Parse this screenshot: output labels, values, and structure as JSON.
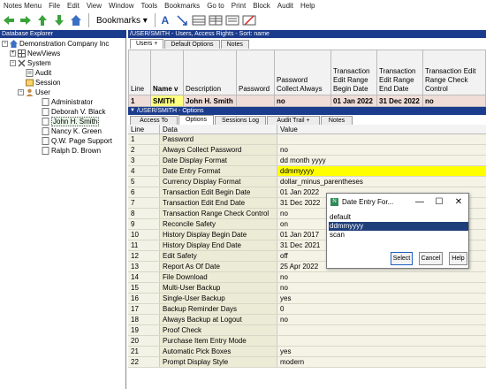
{
  "menu": [
    "Notes Menu",
    "File",
    "Edit",
    "View",
    "Window",
    "Tools",
    "Bookmarks",
    "Go to",
    "Print",
    "Block",
    "Audit",
    "Help"
  ],
  "toolbar": {
    "bookmarks_label": "Bookmarks"
  },
  "explorer": {
    "title": "Database Explorer",
    "root": "Demonstration Company Inc",
    "items": {
      "newviews": "NewViews",
      "system": "System",
      "audit": "Audit",
      "session": "Session",
      "user": "User",
      "users": [
        "Administrator",
        "Deborah V. Black",
        "John H. Smith",
        "Nancy K. Green",
        "Q.W. Page Support",
        "Ralph D. Brown"
      ]
    }
  },
  "user_panel": {
    "title": "/USER/SMITH - Users, Access Rights - Sort: name",
    "tabs": [
      "Users +",
      "Default Options",
      "Notes"
    ],
    "columns": [
      "Line",
      "Name v",
      "Description",
      "Password",
      "Password Collect Always",
      "Transaction Edit Range Begin Date",
      "Transaction Edit Range End Date",
      "Transaction Edit Range Check Control"
    ],
    "row": [
      "1",
      "SMITH",
      "John H. Smith",
      "",
      "no",
      "01 Jan 2022",
      "31 Dec 2022",
      "no"
    ]
  },
  "options_panel": {
    "title": "/USER/SMITH - Options",
    "tabs": [
      "Access To",
      "Options",
      "Sessions Log",
      "Audit Trail +",
      "Notes"
    ],
    "columns": [
      "Line",
      "Data",
      "Value"
    ],
    "rows": [
      [
        "1",
        "Password",
        ""
      ],
      [
        "2",
        "Always Collect Password",
        "no"
      ],
      [
        "3",
        "Date Display Format",
        "dd month yyyy"
      ],
      [
        "4",
        "Date Entry Format",
        "ddmmyyyy"
      ],
      [
        "5",
        "Currency Display Format",
        "dollar_minus_parentheses"
      ],
      [
        "6",
        "Transaction Edit Begin Date",
        "01 Jan 2022"
      ],
      [
        "7",
        "Transaction Edit End Date",
        "31 Dec 2022"
      ],
      [
        "8",
        "Transaction Range Check Control",
        "no"
      ],
      [
        "9",
        "Reconcile Safety",
        "on"
      ],
      [
        "10",
        "History Display Begin Date",
        "01 Jan 2017"
      ],
      [
        "11",
        "History Display End Date",
        "31 Dec 2021"
      ],
      [
        "12",
        "Edit Safety",
        "off"
      ],
      [
        "13",
        "Report As Of Date",
        "25 Apr 2022"
      ],
      [
        "14",
        "File Download",
        "no"
      ],
      [
        "15",
        "Multi-User Backup",
        "no"
      ],
      [
        "16",
        "Single-User Backup",
        "yes"
      ],
      [
        "17",
        "Backup Reminder Days",
        "0"
      ],
      [
        "18",
        "Always Backup at Logout",
        "no"
      ],
      [
        "19",
        "Proof Check",
        ""
      ],
      [
        "20",
        "Purchase Item Entry Mode",
        ""
      ],
      [
        "21",
        "Automatic Pick Boxes",
        "yes"
      ],
      [
        "22",
        "Prompt Display Style",
        "modern"
      ]
    ],
    "highlighted_row": 4
  },
  "dialog": {
    "title": "Date Entry For...",
    "options": [
      "default",
      "ddmmyyyy",
      "scan"
    ],
    "selected": "ddmmyyyy",
    "buttons": {
      "select": "Select",
      "cancel": "Cancel",
      "help": "Help"
    }
  },
  "colors": {
    "title_bar": "#1b3b8c",
    "highlight": "#ffff00",
    "selected_list": "#1e3f7a"
  }
}
